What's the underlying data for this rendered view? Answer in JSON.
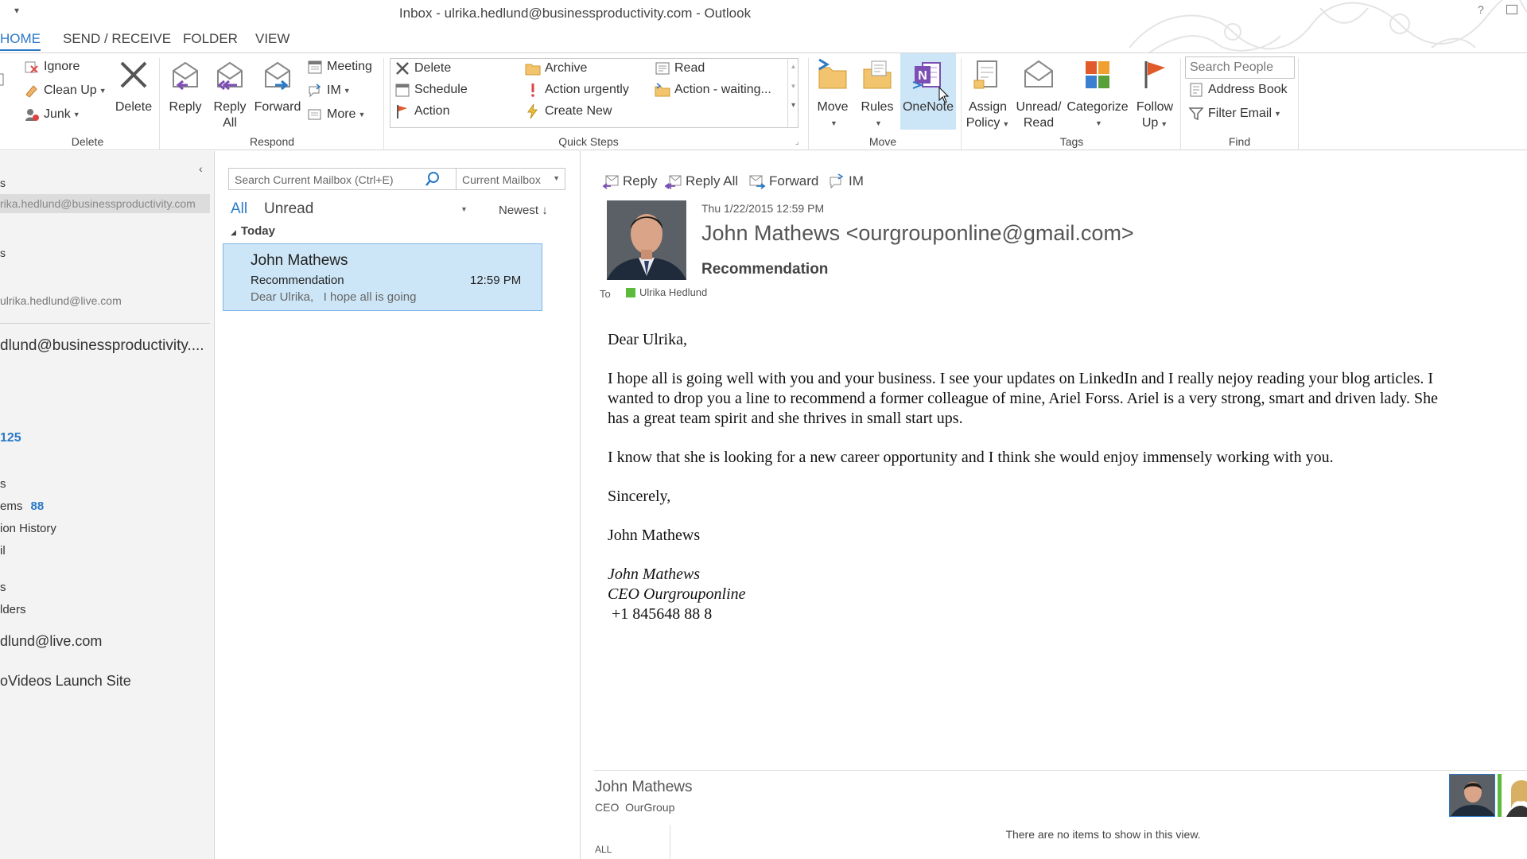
{
  "window": {
    "title": "Inbox - ulrika.hedlund@businessproductivity.com - Outlook",
    "help": "?"
  },
  "tabs": [
    "HOME",
    "SEND / RECEIVE",
    "FOLDER",
    "VIEW"
  ],
  "ribbon": {
    "delete_group": {
      "label": "Delete",
      "ignore": "Ignore",
      "cleanup": "Clean Up",
      "junk": "Junk",
      "delete": "Delete"
    },
    "respond_group": {
      "label": "Respond",
      "reply": "Reply",
      "reply_all_1": "Reply",
      "reply_all_2": "All",
      "forward": "Forward",
      "meeting": "Meeting",
      "im": "IM",
      "more": "More"
    },
    "quick_steps": {
      "label": "Quick Steps",
      "items": [
        "Delete",
        "Schedule",
        "Action",
        "Archive",
        "Action urgently",
        "Create New",
        "Read",
        "Action - waiting..."
      ]
    },
    "move_group": {
      "label": "Move",
      "move": "Move",
      "rules": "Rules",
      "onenote": "OneNote"
    },
    "tags_group": {
      "label": "Tags",
      "assign_1": "Assign",
      "assign_2": "Policy",
      "unread_1": "Unread/",
      "unread_2": "Read",
      "categorize": "Categorize",
      "follow_1": "Follow",
      "follow_2": "Up"
    },
    "find_group": {
      "label": "Find",
      "search_people": "Search People",
      "address_book": "Address Book",
      "filter_email": "Filter Email"
    }
  },
  "sidebar": {
    "items": [
      {
        "text": "s"
      },
      {
        "text": "rika.hedlund@businessproductivity.com"
      },
      {
        "text": "s"
      },
      {
        "text": "ulrika.hedlund@live.com"
      },
      {
        "text": "dlund@businessproductivity...."
      },
      {
        "text": "125"
      },
      {
        "text": "s"
      },
      {
        "text": "ems"
      },
      {
        "text": "88"
      },
      {
        "text": "ion History"
      },
      {
        "text": "il"
      },
      {
        "text": "s"
      },
      {
        "text": "lders"
      },
      {
        "text": "dlund@live.com"
      },
      {
        "text": "oVideos Launch Site"
      }
    ]
  },
  "message_list": {
    "search_placeholder": "Search Current Mailbox (Ctrl+E)",
    "scope": "Current Mailbox",
    "filter_all": "All",
    "filter_unread": "Unread",
    "sort": "Newest",
    "group_header": "Today",
    "messages": [
      {
        "sender": "John Mathews",
        "subject": "Recommendation",
        "time": "12:59 PM",
        "preview": "Dear Ulrika,   I hope all is going"
      }
    ]
  },
  "reading_pane": {
    "toolbar": {
      "reply": "Reply",
      "reply_all": "Reply All",
      "forward": "Forward",
      "im": "IM"
    },
    "date": "Thu 1/22/2015 12:59 PM",
    "from": "John Mathews <ourgrouponline@gmail.com>",
    "subject": "Recommendation",
    "to_label": "To",
    "to": "Ulrika Hedlund",
    "body": {
      "greeting": "Dear Ulrika,",
      "p1_line1": "I hope all is going well with you and your business. I see your updates on LinkedIn and I really nejoy reading your blog articles. I",
      "p1_line2": "wanted to drop you a line to recommend a former colleague of mine, Ariel Forss. Ariel is a very strong, smart and driven lady. She",
      "p1_line3": "has a great team spirit and she thrives in small start ups.",
      "p2": "I know that she is looking for a new career opportunity and I think she would enjoy immensely working with you.",
      "closing": "Sincerely,",
      "name": "John Mathews",
      "sig_name": "John Mathews",
      "sig_title": "CEO Ourgrouponline",
      "sig_phone": " +1 845648 88 8"
    },
    "people_pane": {
      "name": "John Mathews",
      "title": "CEO  OurGroup",
      "tab_all": "ALL",
      "empty": "There are no items to show in this view."
    }
  },
  "colors": {
    "accent": "#2b79c7",
    "selected_row": "#cde6f7",
    "unread_blue": "#2b79c7"
  }
}
